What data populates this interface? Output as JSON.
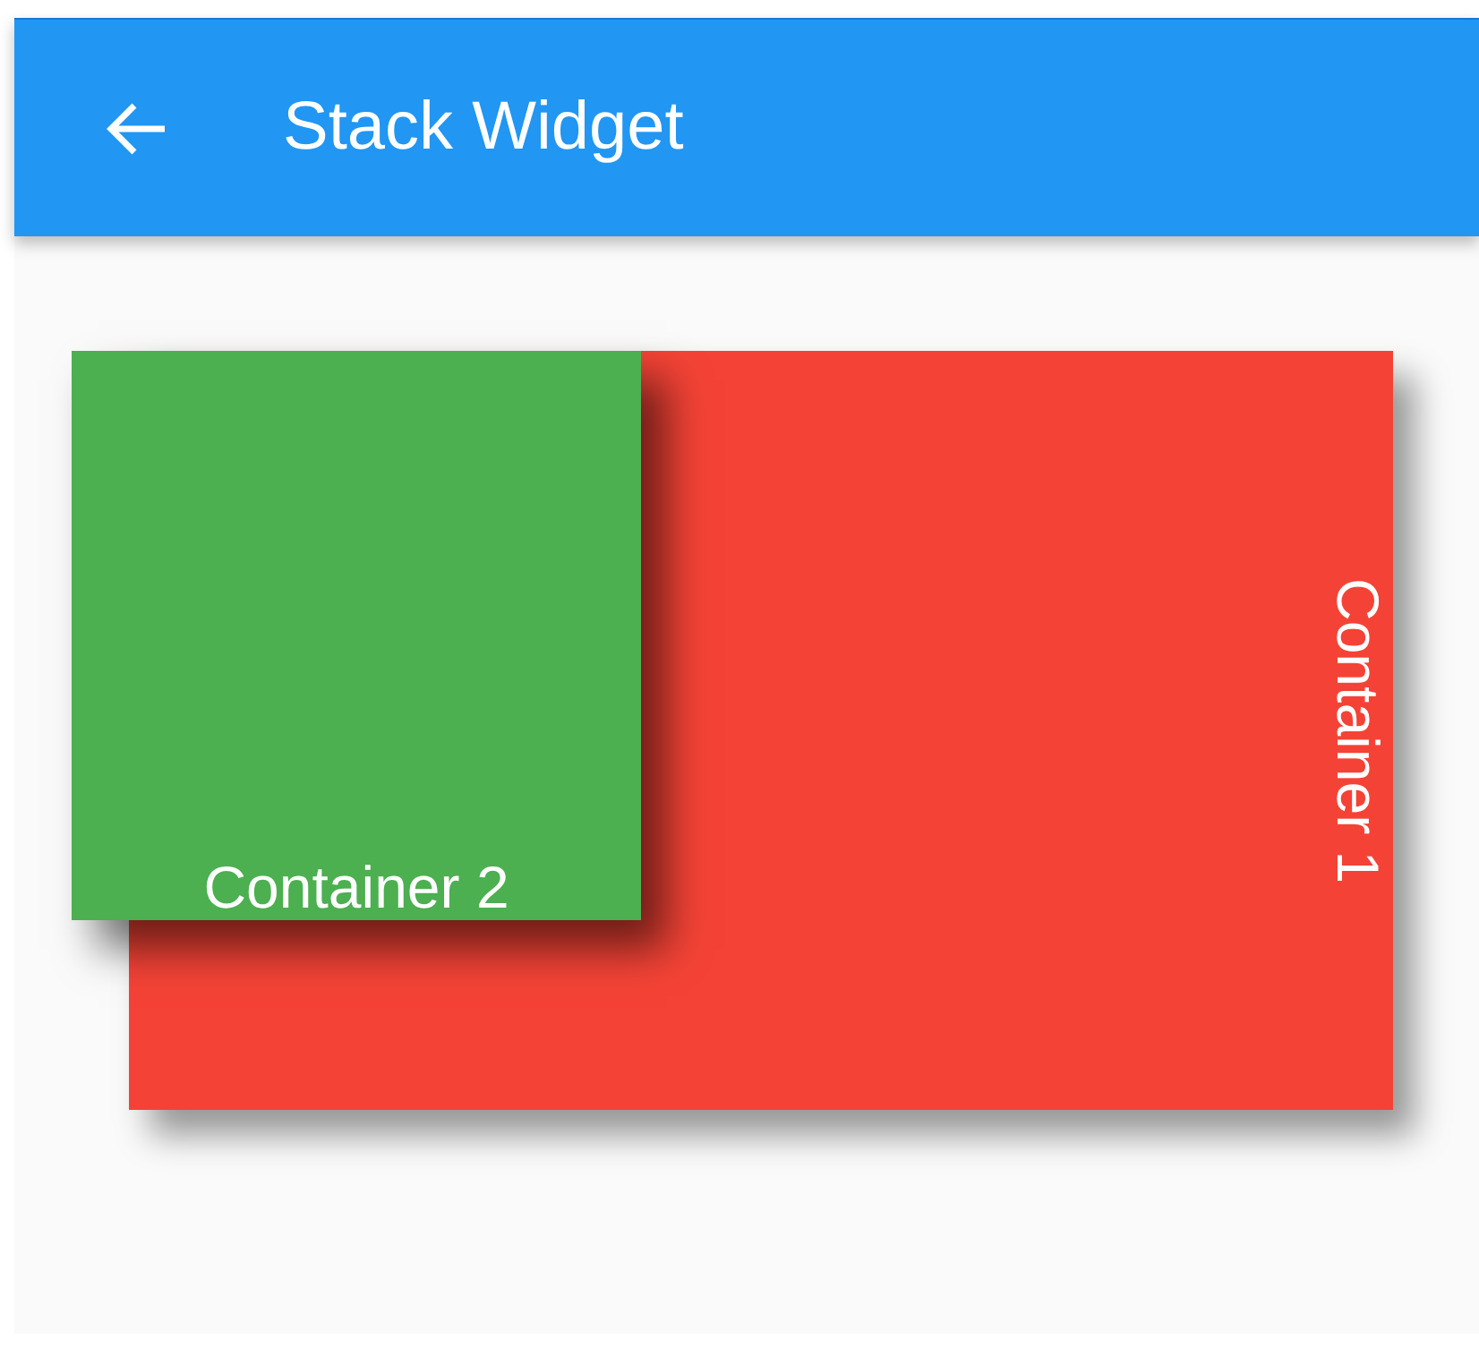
{
  "app_bar": {
    "title": "Stack Widget"
  },
  "containers": [
    {
      "label": "Container 2",
      "color": "#4caf50",
      "kind": "front"
    },
    {
      "label": "Container 1",
      "color": "#f44336",
      "kind": "back"
    }
  ]
}
